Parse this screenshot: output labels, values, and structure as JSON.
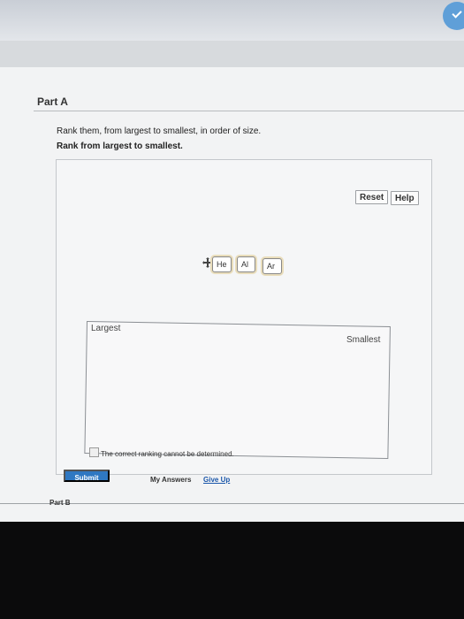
{
  "part_a": {
    "title": "Part A"
  },
  "question": {
    "prompt": "Rank them, from largest to smallest, in order of size.",
    "instruction": "Rank from largest to smallest."
  },
  "toolbar": {
    "reset": "Reset",
    "help": "Help"
  },
  "items": [
    {
      "label": "He"
    },
    {
      "label": "Al"
    },
    {
      "label": "Ar"
    }
  ],
  "ranking": {
    "largest": "Largest",
    "smallest": "Smallest"
  },
  "option": {
    "cannot_determine": "The correct ranking cannot be determined."
  },
  "actions": {
    "submit": "Submit",
    "my_answers": "My Answers",
    "give_up": "Give Up"
  },
  "part_b": {
    "title": "Part B"
  },
  "colors": {
    "accent": "#2f78c2",
    "link": "#1b57aa",
    "chip_highlight": "#e9ddbb"
  }
}
